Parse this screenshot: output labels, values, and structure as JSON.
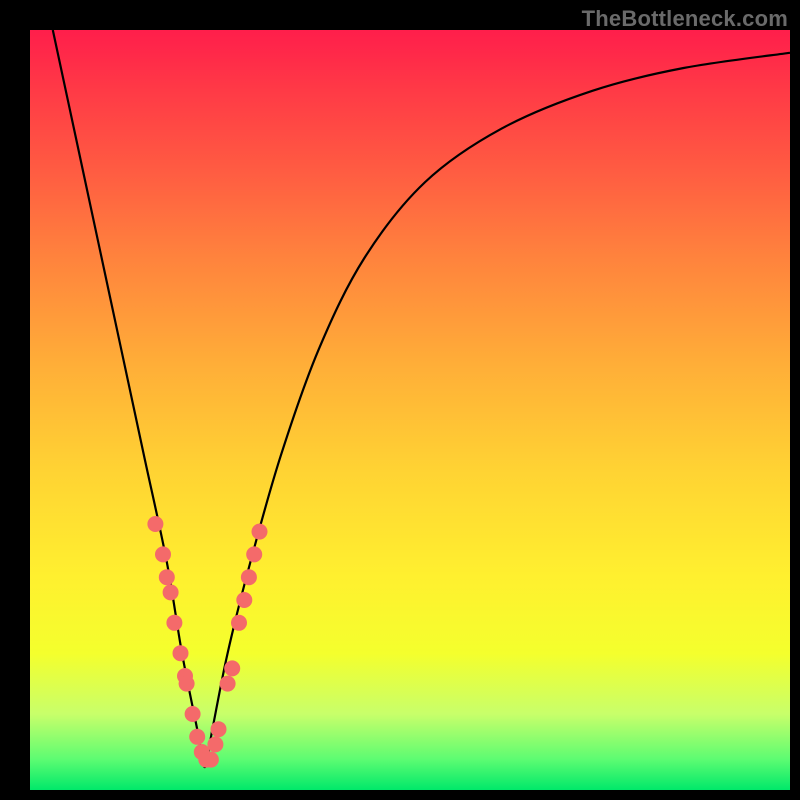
{
  "watermark": {
    "text": "TheBottleneck.com"
  },
  "colors": {
    "curve_stroke": "#000000",
    "dot_fill": "#f46a6a",
    "background_black": "#000000"
  },
  "chart_data": {
    "type": "line",
    "title": "",
    "xlabel": "",
    "ylabel": "",
    "xlim": [
      0,
      100
    ],
    "ylim": [
      0,
      100
    ],
    "note": "Axis values are normalized 0–100 percent of the plot area. The curve is a V-shaped bottleneck response with its minimum near x≈23. The overlaid dots are scattered along the lower part of both branches.",
    "series": [
      {
        "name": "curve",
        "x": [
          3,
          6,
          9,
          12,
          15,
          18,
          20,
          22,
          23,
          24,
          26,
          29,
          33,
          38,
          44,
          52,
          62,
          74,
          86,
          100
        ],
        "y": [
          100,
          86,
          72,
          58,
          44,
          30,
          18,
          8,
          3,
          8,
          18,
          30,
          44,
          58,
          70,
          80,
          87,
          92,
          95,
          97
        ]
      },
      {
        "name": "dots",
        "x": [
          16.5,
          17.5,
          18,
          18.5,
          19,
          19.8,
          20.4,
          20.6,
          21.4,
          22,
          22.6,
          23.2,
          23.8,
          24.4,
          24.8,
          26.0,
          26.6,
          27.5,
          28.2,
          28.8,
          29.5,
          30.2
        ],
        "y": [
          35,
          31,
          28,
          26,
          22,
          18,
          15,
          14,
          10,
          7,
          5,
          4,
          4,
          6,
          8,
          14,
          16,
          22,
          25,
          28,
          31,
          34
        ]
      }
    ]
  }
}
